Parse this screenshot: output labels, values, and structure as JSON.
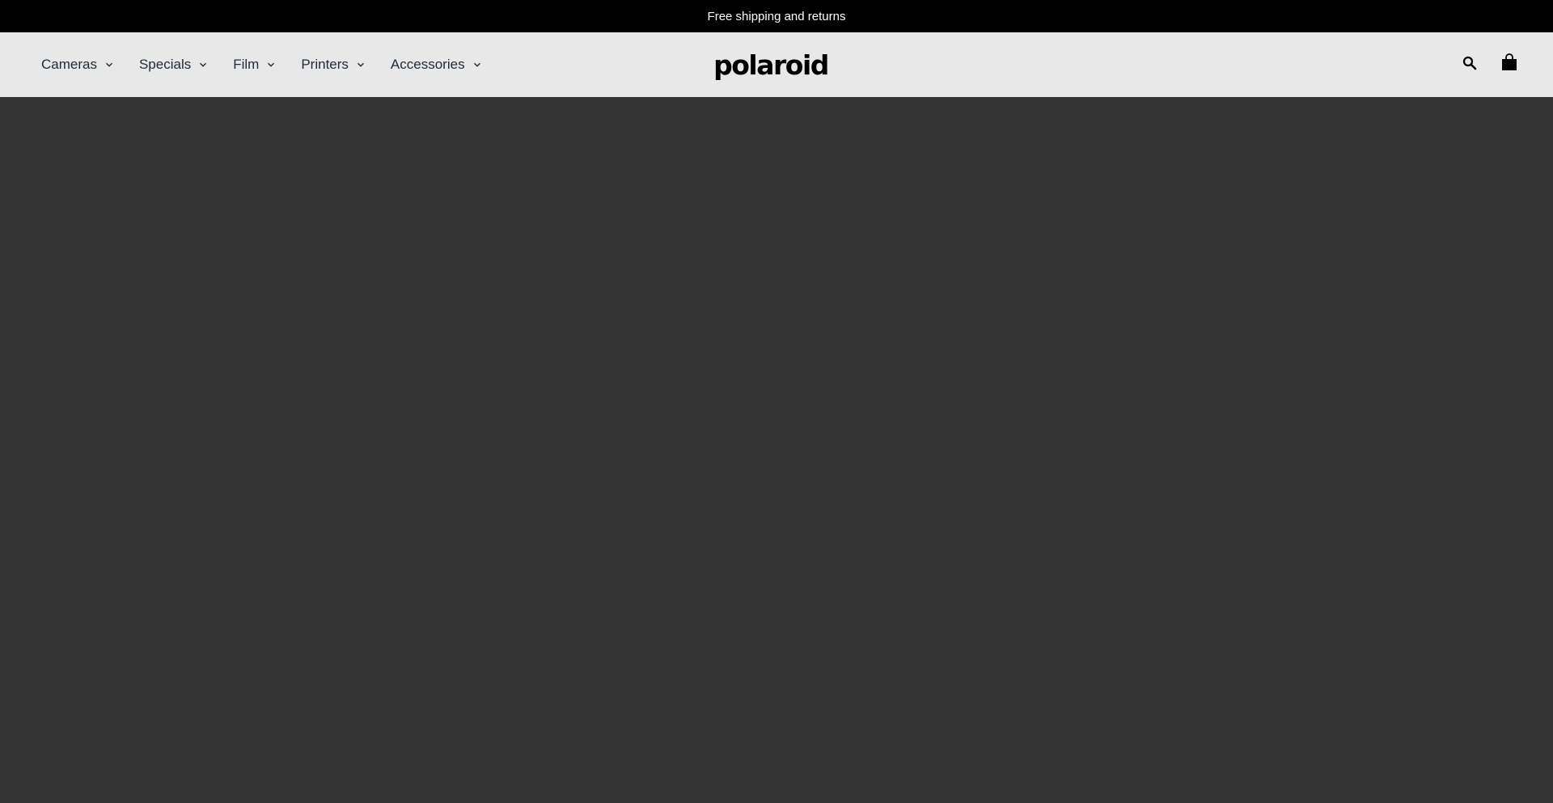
{
  "announcement": {
    "text": "Free shipping and returns"
  },
  "header": {
    "nav": [
      {
        "label": "Cameras"
      },
      {
        "label": "Specials"
      },
      {
        "label": "Film"
      },
      {
        "label": "Printers"
      },
      {
        "label": "Accessories"
      }
    ],
    "logo_text": "polaroid",
    "search_icon": "search-icon",
    "cart_icon": "shopping-bag-icon"
  },
  "colors": {
    "announcement_bg": "#000000",
    "header_bg": "#e8e8e8",
    "main_bg": "#333333",
    "nav_text": "#1f2a3a"
  }
}
